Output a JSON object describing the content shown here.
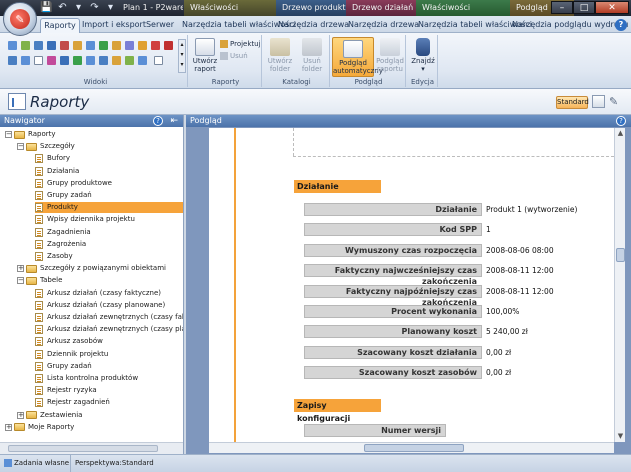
{
  "window": {
    "title": "Plan 1 - P2ware Pl...",
    "contextual_tabs": [
      "Właściwości",
      "Drzewo produktów",
      "Drzewo działań",
      "Właściwości",
      "Podgląd"
    ]
  },
  "ribbon_tabs": [
    {
      "label": "Raporty",
      "active": true
    },
    {
      "label": "Import i eksport",
      "active": false
    },
    {
      "label": "Serwer",
      "active": false
    },
    {
      "label": "Narzędzia tabeli właściwości",
      "active": false
    },
    {
      "label": "Narzędzia drzewa",
      "active": false
    },
    {
      "label": "Narzędzia drzewa",
      "active": false
    },
    {
      "label": "Narzędzia tabeli właściwości",
      "active": false
    },
    {
      "label": "Narzędzia podglądu wydruku",
      "active": false
    }
  ],
  "ribbon": {
    "groups": {
      "widoki": "Widoki",
      "raporty": "Raporty",
      "katalogi": "Katalogi",
      "podglad": "Podgląd",
      "edycja": "Edycja"
    },
    "buttons": {
      "utworz_raport": "Utwórz raport",
      "projektuj": "Projektuj",
      "usun": "Usuń",
      "utworz_folder": "Utwórz folder",
      "usun_folder": "Usuń folder",
      "podglad_automatyczny": "Podgląd automatyczny",
      "podglad_raportu": "Podgląd raportu",
      "znajdz": "Znajdź"
    }
  },
  "header": {
    "title": "Raporty",
    "standard_label": "Standard"
  },
  "navigator": {
    "title": "Nawigator",
    "items": [
      {
        "label": "Raporty",
        "level": 0,
        "type": "folder",
        "expand": "−"
      },
      {
        "label": "Szczegóły",
        "level": 1,
        "type": "folder",
        "expand": "−"
      },
      {
        "label": "Bufory",
        "level": 2,
        "type": "doc"
      },
      {
        "label": "Działania",
        "level": 2,
        "type": "doc"
      },
      {
        "label": "Grupy produktowe",
        "level": 2,
        "type": "doc"
      },
      {
        "label": "Grupy zadań",
        "level": 2,
        "type": "doc"
      },
      {
        "label": "Produkty",
        "level": 2,
        "type": "doc",
        "selected": true
      },
      {
        "label": "Wpisy dziennika projektu",
        "level": 2,
        "type": "doc"
      },
      {
        "label": "Zagadnienia",
        "level": 2,
        "type": "doc"
      },
      {
        "label": "Zagrożenia",
        "level": 2,
        "type": "doc"
      },
      {
        "label": "Zasoby",
        "level": 2,
        "type": "doc"
      },
      {
        "label": "Szczegóły z powiązanymi obiektami",
        "level": 1,
        "type": "folder",
        "expand": "+"
      },
      {
        "label": "Tabele",
        "level": 1,
        "type": "folder",
        "expand": "−"
      },
      {
        "label": "Arkusz działań (czasy faktyczne)",
        "level": 2,
        "type": "doc"
      },
      {
        "label": "Arkusz działań (czasy planowane)",
        "level": 2,
        "type": "doc"
      },
      {
        "label": "Arkusz działań zewnętrznych (czasy fak...",
        "level": 2,
        "type": "doc"
      },
      {
        "label": "Arkusz działań zewnętrznych (czasy pla...",
        "level": 2,
        "type": "doc"
      },
      {
        "label": "Arkusz zasobów",
        "level": 2,
        "type": "doc"
      },
      {
        "label": "Dziennik projektu",
        "level": 2,
        "type": "doc"
      },
      {
        "label": "Grupy zadań",
        "level": 2,
        "type": "doc"
      },
      {
        "label": "Lista kontrolna produktów",
        "level": 2,
        "type": "doc"
      },
      {
        "label": "Rejestr ryzyka",
        "level": 2,
        "type": "doc"
      },
      {
        "label": "Rejestr zagadnień",
        "level": 2,
        "type": "doc"
      },
      {
        "label": "Zestawienia",
        "level": 1,
        "type": "folder",
        "expand": "+"
      },
      {
        "label": "Moje Raporty",
        "level": 0,
        "type": "folder",
        "expand": "+"
      }
    ]
  },
  "preview": {
    "title": "Podgląd",
    "section1_title": "Działanie",
    "fields": [
      {
        "label": "Działanie",
        "value": "Produkt 1 (wytworzenie)"
      },
      {
        "label": "Kod SPP",
        "value": "1"
      },
      {
        "label": "Wymuszony czas rozpoczęcia",
        "value": "2008-08-06 08:00"
      },
      {
        "label": "Faktyczny najwcześniejszy czas zakończenia",
        "value": "2008-08-11 12:00"
      },
      {
        "label": "Faktyczny najpóźniejszy czas zakończenia",
        "value": "2008-08-11 12:00"
      },
      {
        "label": "Procent wykonania",
        "value": "100,00%"
      },
      {
        "label": "Planowany koszt",
        "value": "5 240,00 zł"
      },
      {
        "label": "Szacowany koszt działania",
        "value": "0,00 zł"
      },
      {
        "label": "Szacowany koszt zasobów",
        "value": "0,00 zł"
      }
    ],
    "section2_title": "Zapisy konfiguracji",
    "section2_field": "Numer wersji"
  },
  "status": {
    "item1": "Zadania własne",
    "item2": "Perspektywa:Standard"
  },
  "colors": {
    "accent_orange": "#f6a33a",
    "panel_header_blue": "#4c73aa"
  }
}
